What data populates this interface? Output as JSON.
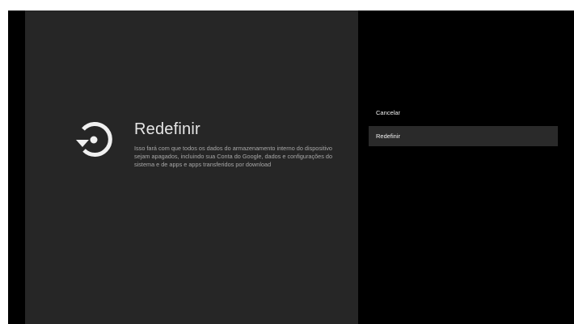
{
  "guidance": {
    "icon": "restore-icon",
    "title": "Redefinir",
    "description": "Isso fará com que todos os dados do armazenamento interno do dispositivo sejam apagados, incluindo sua Conta do Google, dados e configurações do sistema e de apps e apps transferidos por download"
  },
  "actions": {
    "cancel_label": "Cancelar",
    "reset_label": "Redefinir",
    "focused": "Redefinir"
  },
  "colors": {
    "guidance_background": "#262626",
    "actions_background": "#000000",
    "focused_item_background": "#2a2a2a",
    "text_primary": "#e6e6e6",
    "text_secondary": "#a8a8a8"
  }
}
